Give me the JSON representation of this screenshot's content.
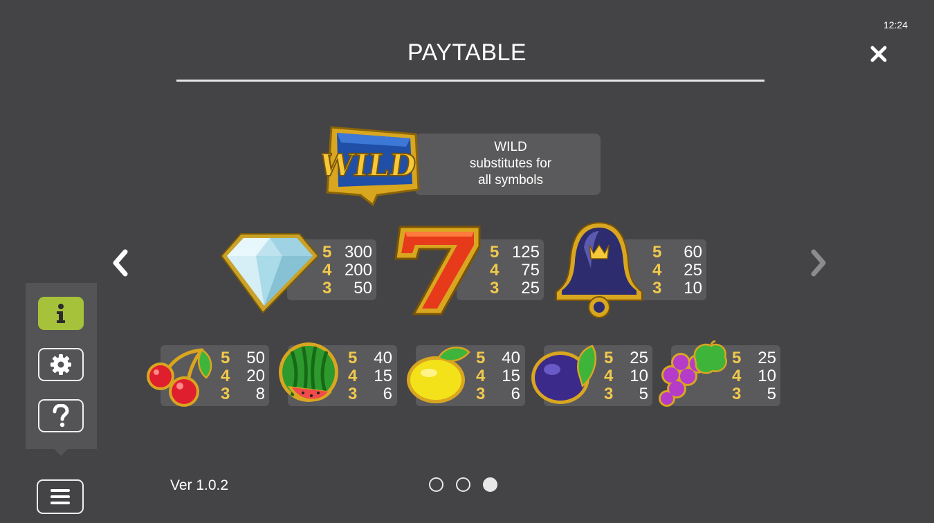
{
  "status": {
    "time": "12:24"
  },
  "header": {
    "title": "PAYTABLE"
  },
  "wild": {
    "lines": [
      "WILD",
      "substitutes for",
      "all symbols"
    ]
  },
  "top_row": [
    {
      "symbol": "diamond-icon",
      "pays": [
        {
          "count": "5",
          "value": "300"
        },
        {
          "count": "4",
          "value": "200"
        },
        {
          "count": "3",
          "value": "50"
        }
      ]
    },
    {
      "symbol": "seven-icon",
      "pays": [
        {
          "count": "5",
          "value": "125"
        },
        {
          "count": "4",
          "value": "75"
        },
        {
          "count": "3",
          "value": "25"
        }
      ]
    },
    {
      "symbol": "bell-icon",
      "pays": [
        {
          "count": "5",
          "value": "60"
        },
        {
          "count": "4",
          "value": "25"
        },
        {
          "count": "3",
          "value": "10"
        }
      ]
    }
  ],
  "bottom_row": [
    {
      "symbol": "cherry-icon",
      "pays": [
        {
          "count": "5",
          "value": "50"
        },
        {
          "count": "4",
          "value": "20"
        },
        {
          "count": "3",
          "value": "8"
        }
      ]
    },
    {
      "symbol": "watermelon-icon",
      "pays": [
        {
          "count": "5",
          "value": "40"
        },
        {
          "count": "4",
          "value": "15"
        },
        {
          "count": "3",
          "value": "6"
        }
      ]
    },
    {
      "symbol": "lemon-icon",
      "pays": [
        {
          "count": "5",
          "value": "40"
        },
        {
          "count": "4",
          "value": "15"
        },
        {
          "count": "3",
          "value": "6"
        }
      ]
    },
    {
      "symbol": "plum-icon",
      "pays": [
        {
          "count": "5",
          "value": "25"
        },
        {
          "count": "4",
          "value": "10"
        },
        {
          "count": "3",
          "value": "5"
        }
      ]
    },
    {
      "symbol": "grapes-icon",
      "pays": [
        {
          "count": "5",
          "value": "25"
        },
        {
          "count": "4",
          "value": "10"
        },
        {
          "count": "3",
          "value": "5"
        }
      ]
    }
  ],
  "footer": {
    "version": "Ver 1.0.2"
  },
  "pagination": {
    "total": 3,
    "current": 3
  },
  "colors": {
    "background": "#444446",
    "panel": "#5a5a5c",
    "multiplier": "#f2c94c",
    "active_menu": "#a6c23a"
  },
  "menu": {
    "items": [
      "info-icon",
      "gear-icon",
      "question-icon"
    ],
    "active": "info-icon"
  }
}
